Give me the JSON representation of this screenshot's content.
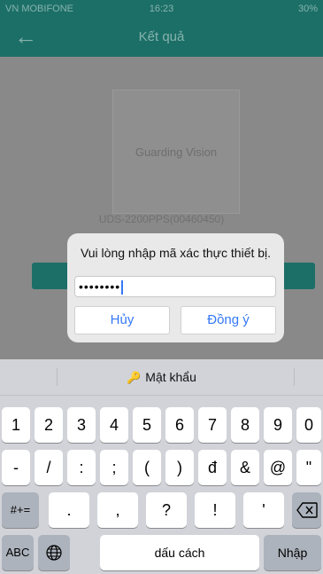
{
  "status_bar": {
    "carrier": "VN MOBIFONE",
    "time": "16:23",
    "battery": "30%"
  },
  "nav": {
    "back_icon": "arrow-left-icon",
    "title": "Kết quả"
  },
  "device": {
    "logo_text": "Guarding Vision",
    "serial": "UDS-2200PPS(00460450)",
    "button_label": ""
  },
  "dialog": {
    "message": "Vui lòng nhập mã xác thực thiết bị.",
    "password_value": "••••••••",
    "cancel_label": "Hủy",
    "ok_label": "Đồng ý"
  },
  "keyboard": {
    "suggestion_label": "Mật khẩu",
    "row1": [
      "1",
      "2",
      "3",
      "4",
      "5",
      "6",
      "7",
      "8",
      "9",
      "0"
    ],
    "row2": [
      "-",
      "/",
      ":",
      ";",
      "(",
      ")",
      "đ",
      "&",
      "@",
      "\""
    ],
    "row3": [
      ".",
      ",",
      "?",
      "!",
      "'"
    ],
    "symbols_key": "#+=",
    "backspace_icon": "backspace-icon",
    "abc_key": "ABC",
    "globe_icon": "globe-icon",
    "space_label": "dấu cách",
    "return_label": "Nhập"
  },
  "colors": {
    "teal": "#1c6f67",
    "dialog_blue": "#3478f6",
    "keyboard_bg": "#d1d3d9"
  }
}
